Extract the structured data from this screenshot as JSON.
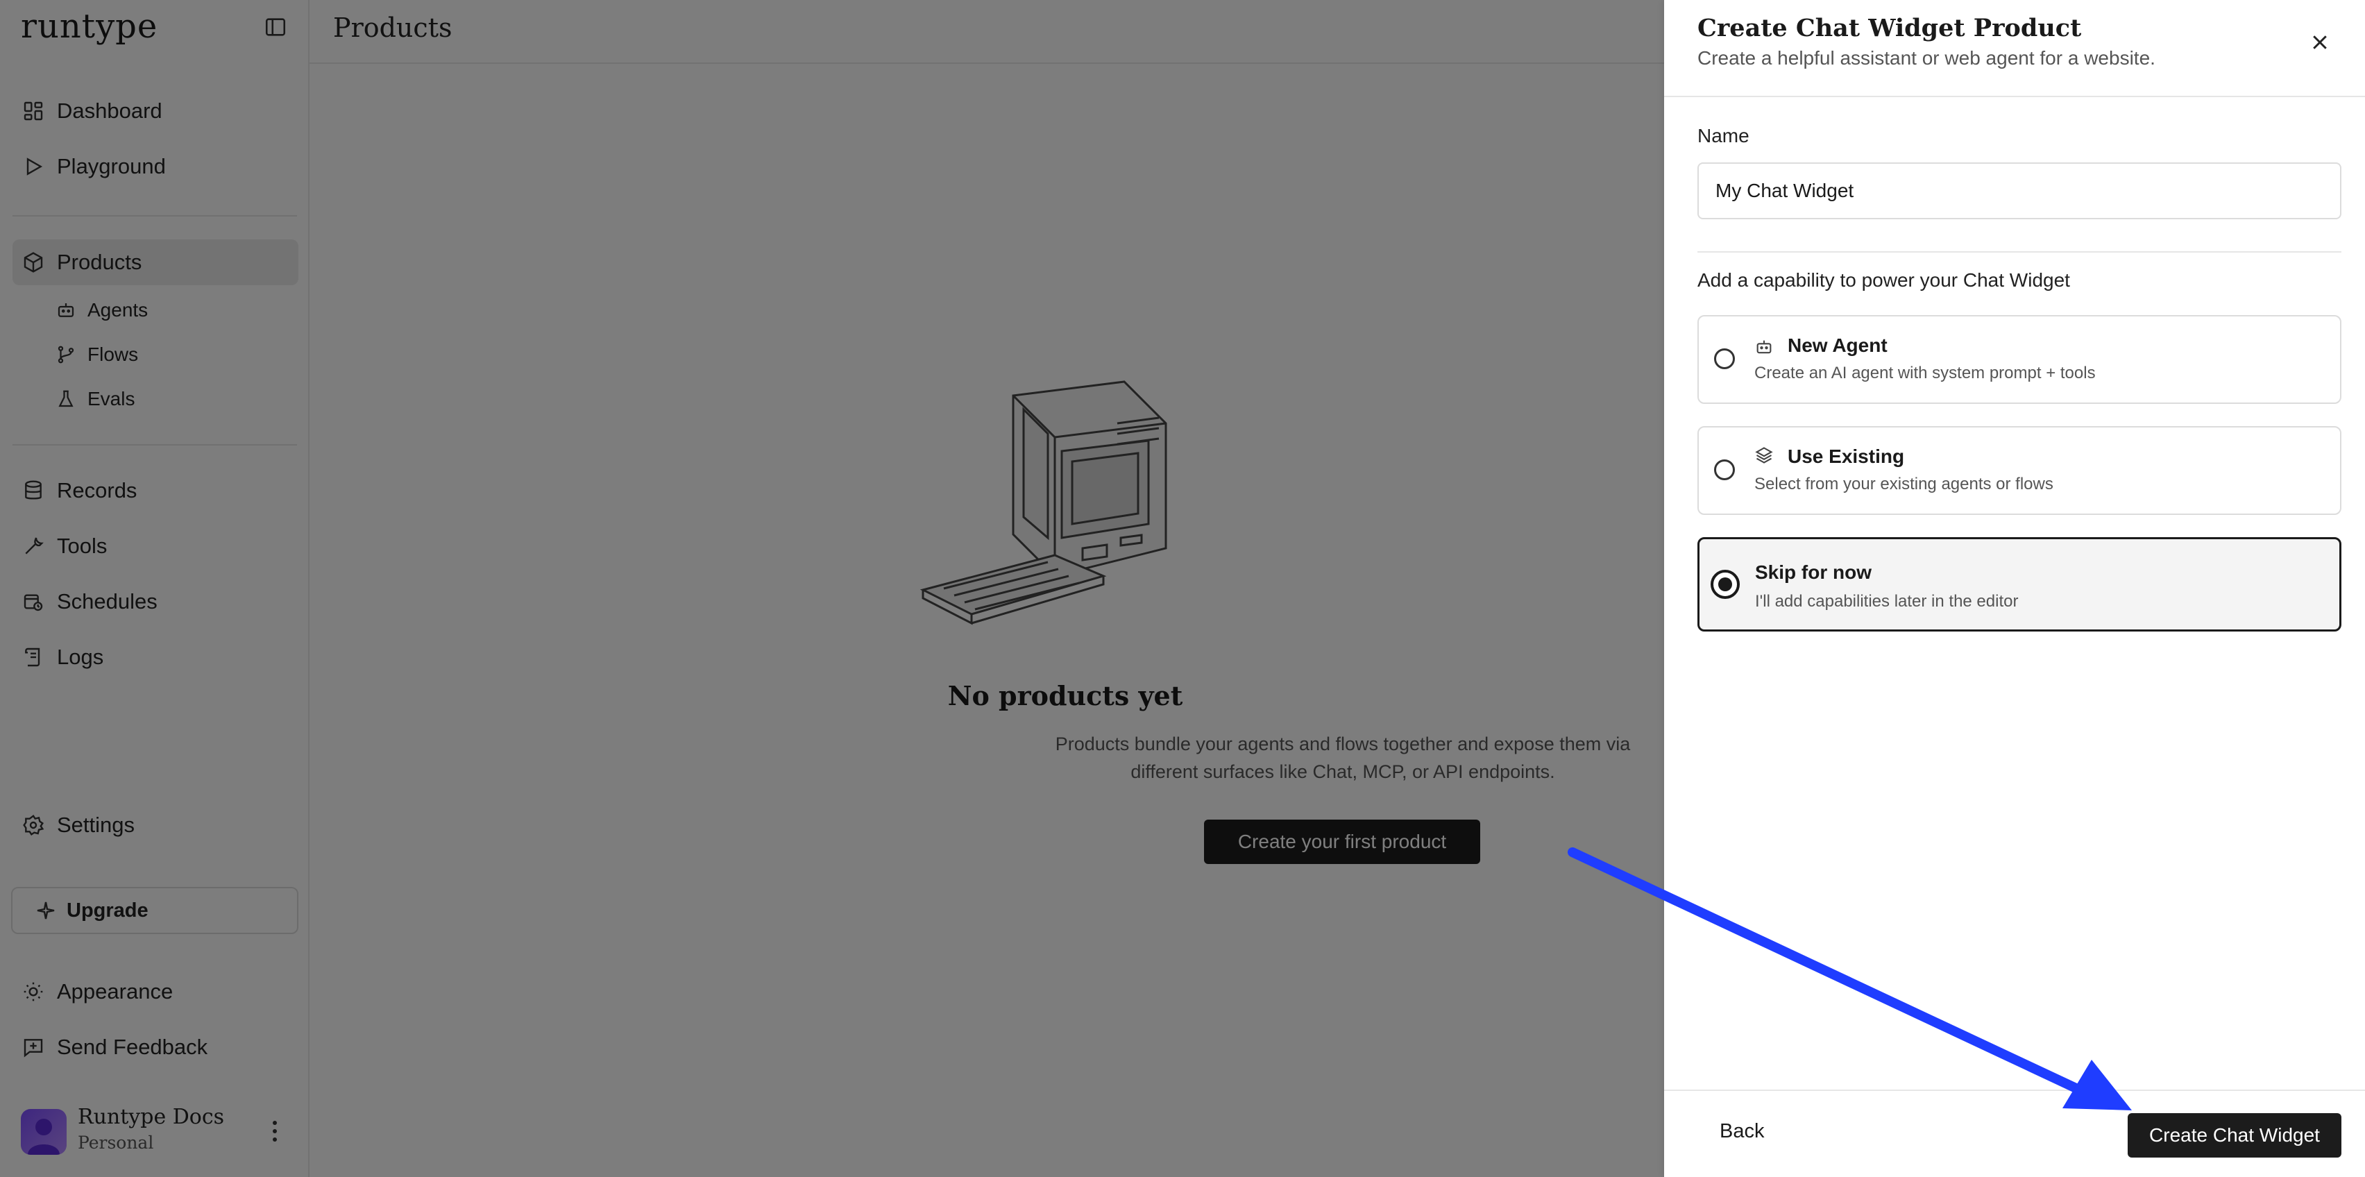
{
  "app": {
    "brand": "runtype"
  },
  "sidebar": {
    "nav": [
      {
        "label": "Dashboard",
        "icon": "grid-icon"
      },
      {
        "label": "Playground",
        "icon": "play-icon"
      },
      {
        "label": "Products",
        "icon": "cube-icon",
        "active": true
      }
    ],
    "sub_items": [
      {
        "label": "Agents",
        "icon": "robot-icon"
      },
      {
        "label": "Flows",
        "icon": "branch-icon"
      },
      {
        "label": "Evals",
        "icon": "flask-icon"
      }
    ],
    "nav2": [
      {
        "label": "Records",
        "icon": "database-icon"
      },
      {
        "label": "Tools",
        "icon": "wrench-icon"
      },
      {
        "label": "Schedules",
        "icon": "calendar-clock-icon"
      },
      {
        "label": "Logs",
        "icon": "scroll-icon"
      }
    ],
    "settings": "Settings",
    "upgrade": "Upgrade",
    "appearance": "Appearance",
    "feedback": "Send Feedback",
    "profile": {
      "name": "Runtype Docs",
      "plan": "Personal"
    }
  },
  "main": {
    "title": "Products",
    "empty": {
      "title": "No products yet",
      "description": "Products bundle your agents and flows together and expose them via different surfaces like Chat, MCP, or API endpoints.",
      "cta": "Create your first product"
    }
  },
  "panel": {
    "title": "Create Chat Widget Product",
    "subtitle": "Create a helpful assistant or web agent for a website.",
    "name_label": "Name",
    "name_value": "My Chat Widget",
    "capability_label": "Add a capability to power your Chat Widget",
    "options": [
      {
        "title": "New Agent",
        "description": "Create an AI agent with system prompt + tools",
        "icon": "robot-icon",
        "selected": false
      },
      {
        "title": "Use Existing",
        "description": "Select from your existing agents or flows",
        "icon": "layers-icon",
        "selected": false
      },
      {
        "title": "Skip for now",
        "description": "I'll add capabilities later in the editor",
        "icon": "",
        "selected": true
      }
    ],
    "back_label": "Back",
    "submit_label": "Create Chat Widget"
  },
  "colors": {
    "annotation_arrow": "#1f3dff",
    "primary_button": "#1c1c1c"
  }
}
